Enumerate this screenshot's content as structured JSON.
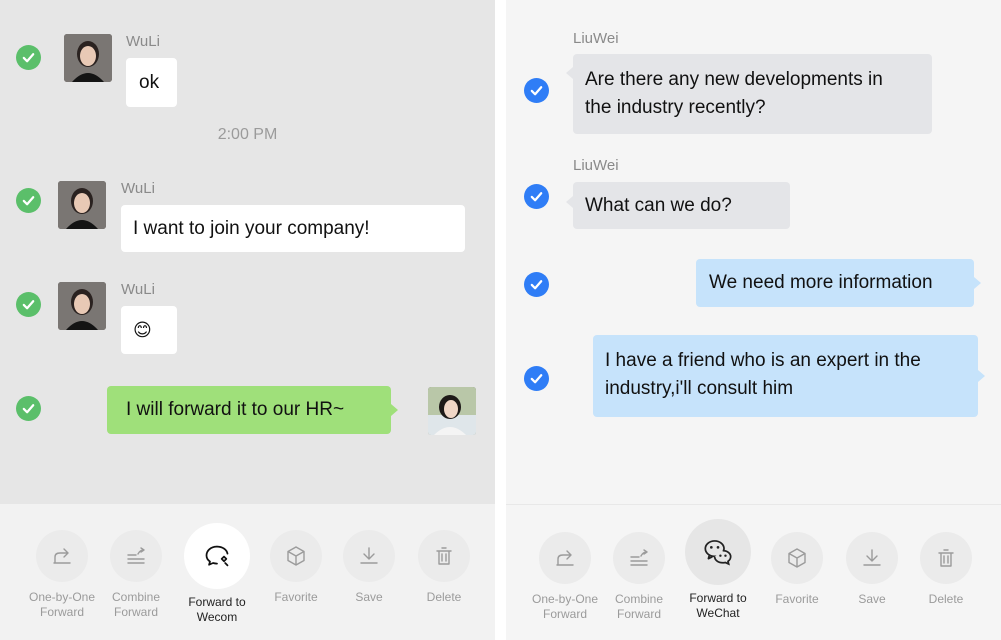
{
  "left": {
    "messages": [
      {
        "sender": "WuLi",
        "text": "ok"
      },
      {
        "sender": "WuLi",
        "text": "I want to join your company!"
      },
      {
        "sender": "WuLi",
        "text": "😊"
      },
      {
        "sender": "",
        "text": "I will forward it to our HR~"
      }
    ],
    "timestamp": "2:00 PM",
    "toolbar": [
      {
        "label1": "One-by-One",
        "label2": "Forward",
        "icon": "share-icon"
      },
      {
        "label1": "Combine",
        "label2": "Forward",
        "icon": "combine-forward-icon"
      },
      {
        "label1": "Forward to",
        "label2": "Wecom",
        "icon": "wecom-icon"
      },
      {
        "label1": "Favorite",
        "label2": "",
        "icon": "cube-icon"
      },
      {
        "label1": "Save",
        "label2": "",
        "icon": "download-icon"
      },
      {
        "label1": "Delete",
        "label2": "",
        "icon": "trash-icon"
      }
    ]
  },
  "right": {
    "messages": [
      {
        "sender": "LiuWei",
        "line1": "Are there any new developments in",
        "line2": "the industry recently?"
      },
      {
        "sender": "LiuWei",
        "line1": "What can we do?"
      },
      {
        "sender": "",
        "line1": "We need more information"
      },
      {
        "sender": "",
        "line1": "I have a friend who is an expert in the",
        "line2": "industry,i'll consult him"
      }
    ],
    "toolbar": [
      {
        "label1": "One-by-One",
        "label2": "Forward",
        "icon": "share-icon"
      },
      {
        "label1": "Combine",
        "label2": "Forward",
        "icon": "combine-forward-icon"
      },
      {
        "label1": "Forward to",
        "label2": "WeChat",
        "icon": "wechat-icon"
      },
      {
        "label1": "Favorite",
        "label2": "",
        "icon": "cube-icon"
      },
      {
        "label1": "Save",
        "label2": "",
        "icon": "download-icon"
      },
      {
        "label1": "Delete",
        "label2": "",
        "icon": "trash-icon"
      }
    ]
  },
  "colors": {
    "left_background": "#e6e6e6",
    "right_background": "#f5f5f5",
    "wecom_check": "#5bbf6a",
    "wechat_check": "#2f7df6",
    "outgoing_green": "#9fe07a",
    "outgoing_blue": "#c6e3fb"
  }
}
